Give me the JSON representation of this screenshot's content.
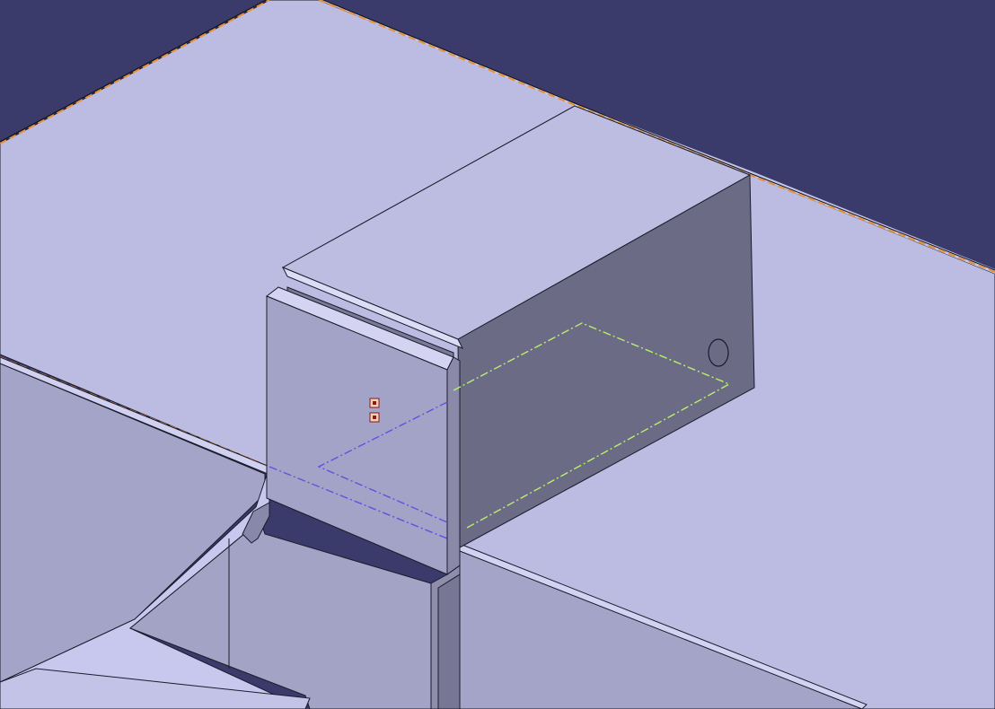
{
  "viewport": {
    "background_color": "#3a3a6b",
    "description_colors": {
      "plate_top": "#bbbbe0",
      "plate_face": "#a4a4c8",
      "bracket_front": "#a3a3c8",
      "bracket_side": "#6b6b86",
      "bracket_top": "#bdbde2",
      "edge_highlight": "#e69138",
      "sketch_yellow_green": "#b9f06a",
      "sketch_purple": "#6b4ddd",
      "point_marker": "#c0392b"
    }
  }
}
